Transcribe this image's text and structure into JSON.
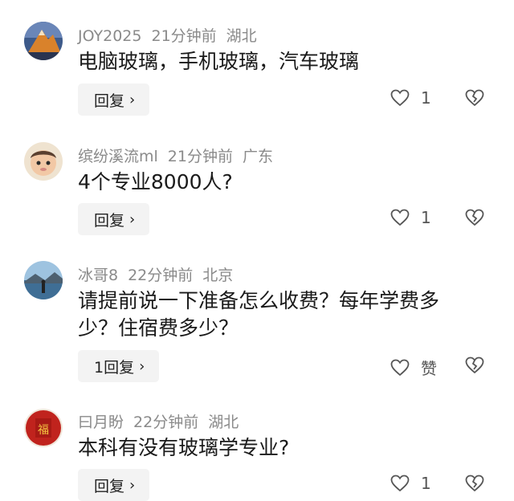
{
  "comments": [
    {
      "username": "JOY2025",
      "time": "21分钟前",
      "location": "湖北",
      "text": "电脑玻璃，手机玻璃，汽车玻璃",
      "reply_label": "回复",
      "like_count": "1",
      "avatar": "mountain-avatar"
    },
    {
      "username": "缤纷溪流ml",
      "time": "21分钟前",
      "location": "广东",
      "text": "4个专业8000人?",
      "reply_label": "回复",
      "like_count": "1",
      "avatar": "baby-avatar"
    },
    {
      "username": "冰哥8",
      "time": "22分钟前",
      "location": "北京",
      "text": "请提前说一下准备怎么收费？每年学费多少？住宿费多少？",
      "reply_label": "1回复",
      "like_count": "赞",
      "avatar": "lake-avatar"
    },
    {
      "username": "曰月盼",
      "time": "22分钟前",
      "location": "湖北",
      "text": "本科有没有玻璃学专业?",
      "reply_label": "回复",
      "like_count": "1",
      "avatar": "fu-avatar"
    }
  ]
}
